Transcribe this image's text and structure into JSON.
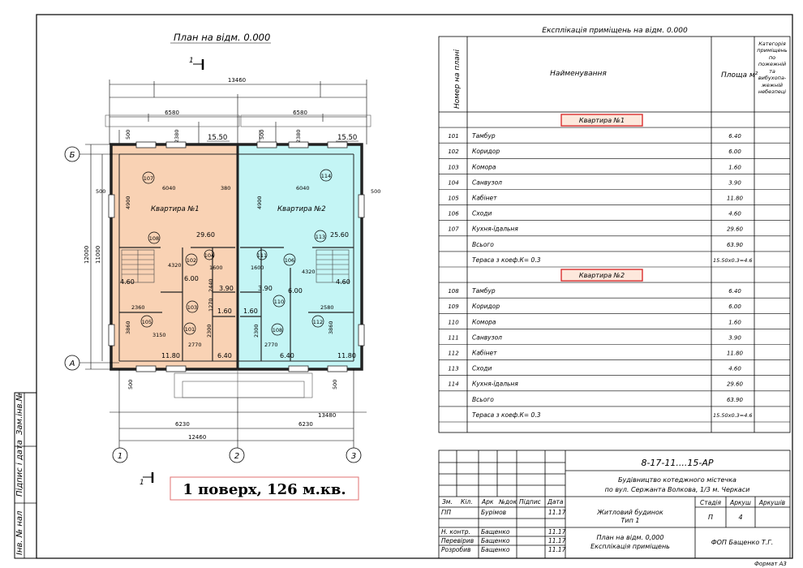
{
  "plan": {
    "title": "План на відм. 0.000",
    "section_mark": "1",
    "axes_letters": [
      "Б",
      "А"
    ],
    "axes_numbers": [
      "1",
      "2",
      "3"
    ],
    "apt1_label": "Квартира №1",
    "apt2_label": "Квартира №2",
    "dims": {
      "top_total": "13460",
      "top_left": "6580",
      "top_right": "6580",
      "bottom_total_1": "13480",
      "bottom_left": "6230",
      "bottom_right": "6230",
      "bottom_total_2": "12460",
      "left_outer": "12000",
      "left_inner": "11000",
      "d500a": "500",
      "d2380a": "2380",
      "d500b": "500",
      "d2380b": "2380",
      "d500c": "500",
      "d500d": "500",
      "d4900a": "4900",
      "d4900b": "4900",
      "d6040a": "6040",
      "d6040b": "6040",
      "d380": "380",
      "d4320a": "4320",
      "d4320b": "4320",
      "d2360": "2360",
      "d2580": "2580",
      "d3860a": "3860",
      "d3860b": "3860",
      "d3150": "3150",
      "d2770a": "2770",
      "d2770b": "2770",
      "d2300a": "2300",
      "d2300b": "2300",
      "d1600a": "1600",
      "d1600b": "1600",
      "d2440": "2440",
      "d1270": "1270",
      "d500e": "500",
      "d500f": "500"
    },
    "areas": {
      "terrace_l": "15.50",
      "terrace_r": "15.50",
      "r107": "29.60",
      "r113": "25.60",
      "r102": "6.00",
      "r106": "6.00",
      "r104": "3.90",
      "r111": "3.90",
      "r103": "1.60",
      "r110": "1.60",
      "r105": "4.60",
      "r112": "4.60",
      "r101": "11.80",
      "r108": "11.80",
      "r108b": "6.40",
      "r101b": "6.40"
    },
    "rooms": [
      "107",
      "114",
      "108",
      "113",
      "102",
      "106",
      "104",
      "111",
      "103",
      "110",
      "105",
      "112",
      "101",
      "108",
      "1"
    ]
  },
  "explication": {
    "title": "Експлікація приміщень на відм. 0.000",
    "col_number": "Номер на плані",
    "col_name": "Найменування",
    "col_area": "Площа м²",
    "col_category": "Категорія приміщень по пожежній та вибухопа-жежній небезпеці",
    "section1": "Квартира №1",
    "section2": "Квартира №2",
    "rows1": [
      {
        "n": "101",
        "name": "Тамбур",
        "area": "6.40"
      },
      {
        "n": "102",
        "name": "Коридор",
        "area": "6.00"
      },
      {
        "n": "103",
        "name": "Комора",
        "area": "1.60"
      },
      {
        "n": "104",
        "name": "Санвузол",
        "area": "3.90"
      },
      {
        "n": "105",
        "name": "Кабінет",
        "area": "11.80"
      },
      {
        "n": "106",
        "name": "Сходи",
        "area": "4.60"
      },
      {
        "n": "107",
        "name": "Кухня-їдальня",
        "area": "29.60"
      },
      {
        "n": "",
        "name": "Всього",
        "area": "63.90"
      },
      {
        "n": "",
        "name": "Тераса з коеф.К= 0.3",
        "area": "15.50х0.3=4.6"
      }
    ],
    "rows2": [
      {
        "n": "108",
        "name": "Тамбур",
        "area": "6.40"
      },
      {
        "n": "109",
        "name": "Коридор",
        "area": "6.00"
      },
      {
        "n": "110",
        "name": "Комора",
        "area": "1.60"
      },
      {
        "n": "111",
        "name": "Санвузол",
        "area": "3.90"
      },
      {
        "n": "112",
        "name": "Кабінет",
        "area": "11.80"
      },
      {
        "n": "113",
        "name": "Сходи",
        "area": "4.60"
      },
      {
        "n": "114",
        "name": "Кухня-їдальня",
        "area": "29.60"
      },
      {
        "n": "",
        "name": "Всього",
        "area": "63.90"
      },
      {
        "n": "",
        "name": "Тераса з коеф.К= 0.3",
        "area": "15.50х0.3=4.6"
      }
    ]
  },
  "stamp": {
    "code": "8-17-11....15-АР",
    "project": "Будівництво котеджного містечка",
    "address": "по вул. Сержанта Волкова, 1/3 м. Черкаси",
    "headers": [
      "Зм.",
      "Кіл.",
      "Арк",
      "№док",
      "Підпис",
      "Дата"
    ],
    "people": [
      {
        "role": "ГІП",
        "name": "Бурімов",
        "date": "11.17"
      },
      {
        "role": "",
        "name": "",
        "date": ""
      },
      {
        "role": "Н. контр.",
        "name": "Бащенко",
        "date": "11.17"
      },
      {
        "role": "Перевірив",
        "name": "Бащенко",
        "date": "11.17"
      },
      {
        "role": "Розробив",
        "name": "Бащенко",
        "date": "11.17"
      }
    ],
    "building": "Житловий будинок",
    "type": "Тип 1",
    "sheet_title_1": "План на відм. 0,000",
    "sheet_title_2": "Експлікація приміщень",
    "stage_h": "Стадія",
    "sheet_h": "Аркуш",
    "sheets_h": "Аркушів",
    "stage": "П",
    "sheet": "4",
    "firm": "ФОП Бащенко Т.Г.",
    "format": "Формат А3"
  },
  "side_labels": [
    "Зам.інв.№",
    "Підпис і дата",
    "Інв. № нал"
  ],
  "caption": "1 поверх, 126 м.кв."
}
